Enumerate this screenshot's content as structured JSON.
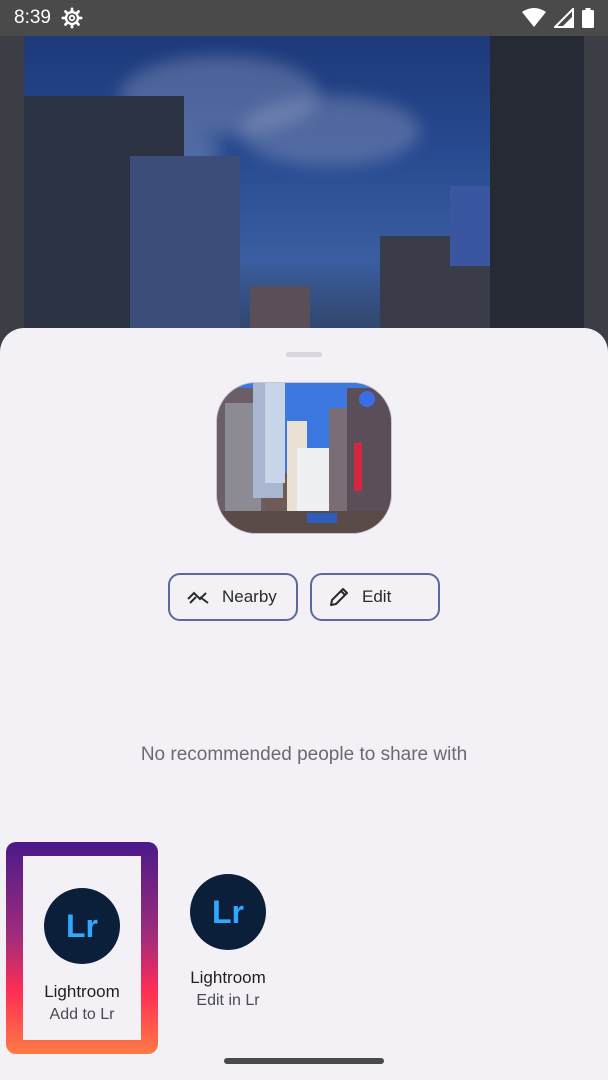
{
  "status": {
    "time": "8:39",
    "icons": [
      "settings-gear-icon",
      "wifi-icon",
      "signal-icon",
      "battery-icon"
    ]
  },
  "share": {
    "actions": [
      {
        "label": "Nearby",
        "icon": "nearby-share-icon"
      },
      {
        "label": "Edit",
        "icon": "pencil-icon"
      }
    ],
    "no_recommendations": "No recommended people to share with",
    "targets": [
      {
        "icon_text": "Lr",
        "name": "Lightroom",
        "subtitle": "Add to Lr"
      },
      {
        "icon_text": "Lr",
        "name": "Lightroom",
        "subtitle": "Edit in Lr"
      }
    ]
  },
  "colors": {
    "lr_bg": "#0b1f3a",
    "lr_text": "#31a8ff",
    "chip_border": "#5a6a9a"
  }
}
